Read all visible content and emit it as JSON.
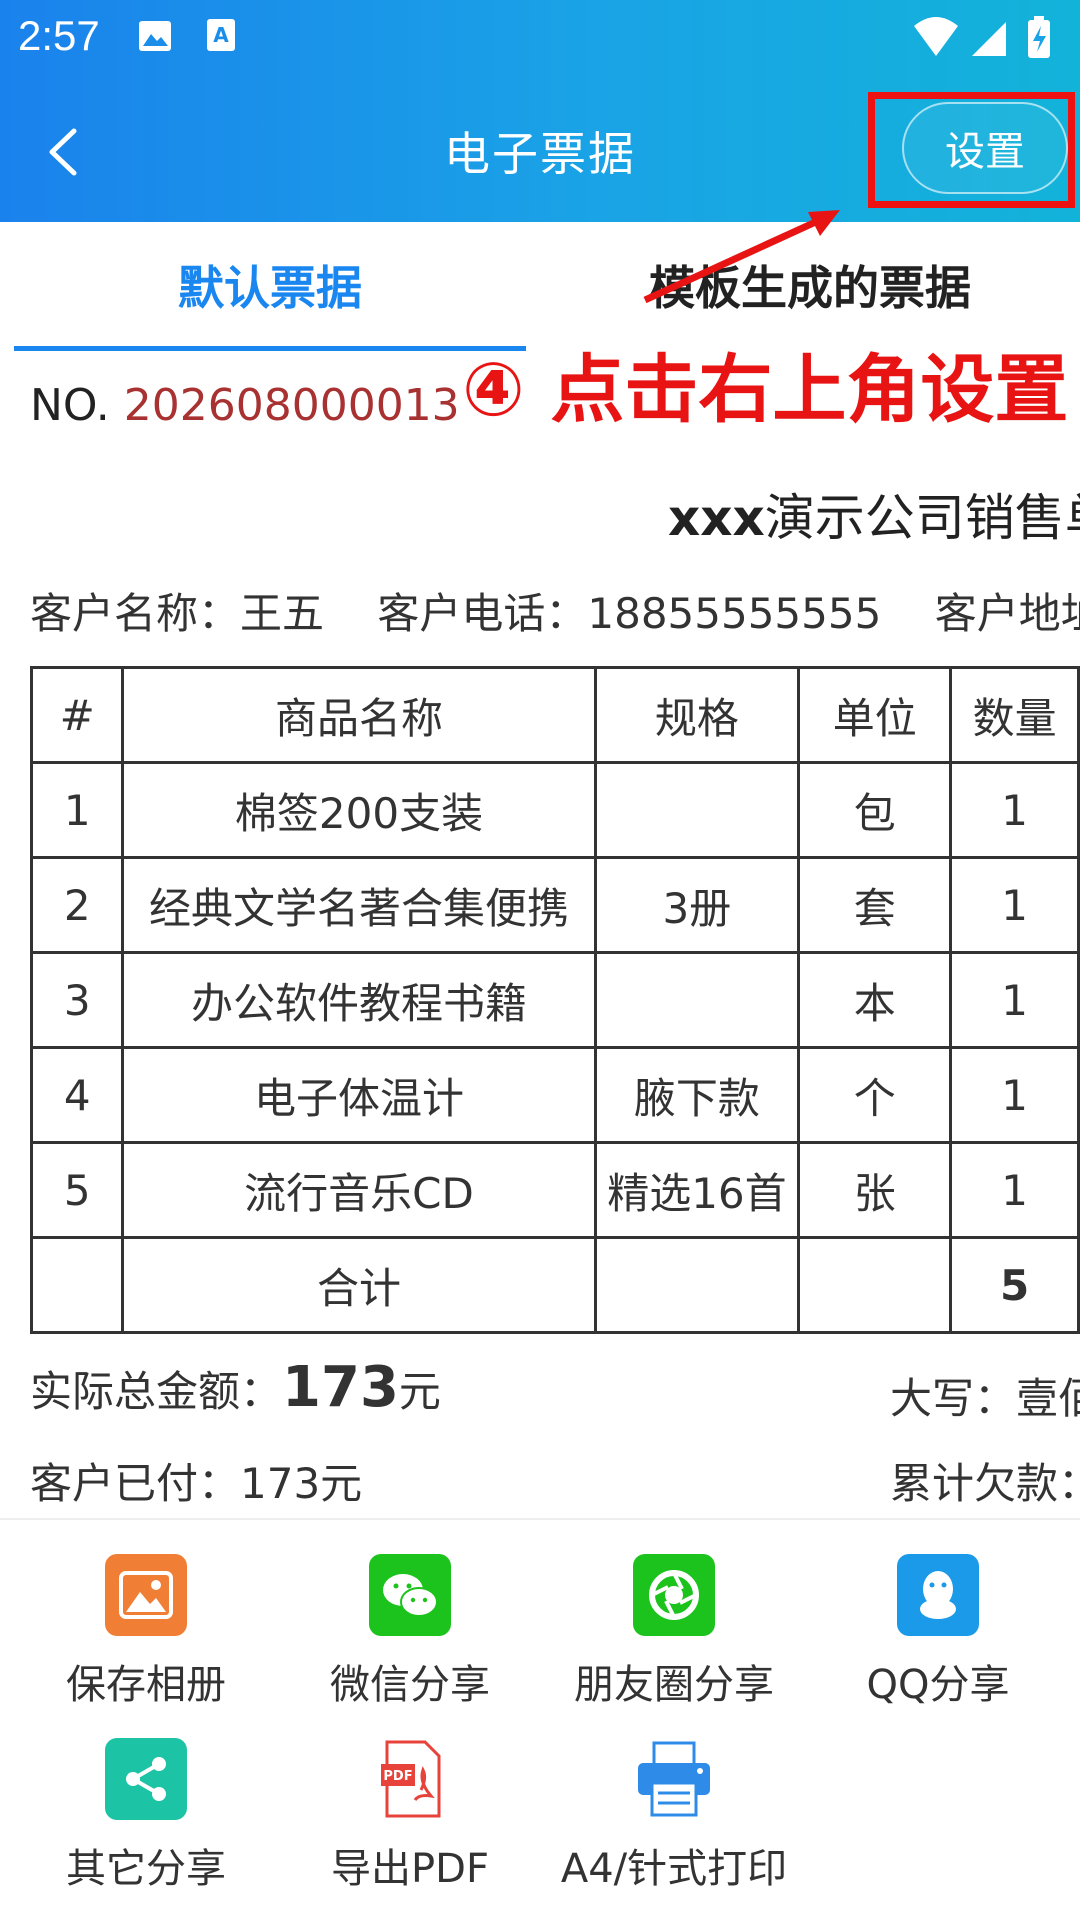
{
  "status_bar": {
    "time": "2:57"
  },
  "app_bar": {
    "title": "电子票据",
    "settings_label": "设置"
  },
  "tabs": [
    {
      "label": "默认票据",
      "active": true
    },
    {
      "label": "模板生成的票据",
      "active": false
    }
  ],
  "annotation": {
    "text": "④ 点击右上角设置",
    "color": "#e81414"
  },
  "receipt": {
    "no_label": "NO.",
    "no_value": "202608000013",
    "title_bold": "xxx",
    "title_rest": "演示公司销售单",
    "customer_name": "客户名称：王五",
    "customer_phone": "客户电话：18855555555",
    "customer_address": "客户地址",
    "table": {
      "headers": [
        "#",
        "商品名称",
        "规格",
        "单位",
        "数量"
      ],
      "rows": [
        [
          "1",
          "棉签200支装",
          "",
          "包",
          "1"
        ],
        [
          "2",
          "经典文学名著合集便携",
          "3册",
          "套",
          "1"
        ],
        [
          "3",
          "办公软件教程书籍",
          "",
          "本",
          "1"
        ],
        [
          "4",
          "电子体温计",
          "腋下款",
          "个",
          "1"
        ],
        [
          "5",
          "流行音乐CD",
          "精选16首",
          "张",
          "1"
        ]
      ],
      "total_label": "合计",
      "total_qty": "5"
    },
    "actual_total_label": "实际总金额：",
    "actual_total_value": "173",
    "actual_total_unit": "元",
    "uppercase_label": "大写：壹佰",
    "paid_label": "客户已付：173元",
    "owed_label": "累计欠款："
  },
  "actions": [
    {
      "label": "保存相册",
      "icon": "gallery-icon",
      "color": "#f07f35"
    },
    {
      "label": "微信分享",
      "icon": "wechat-icon",
      "color": "#1dc31d"
    },
    {
      "label": "朋友圈分享",
      "icon": "moments-icon",
      "color": "#1dc31d"
    },
    {
      "label": "QQ分享",
      "icon": "qq-icon",
      "color": "#1a9ae8"
    },
    {
      "label": "其它分享",
      "icon": "share-icon",
      "color": "#1cc3a4"
    },
    {
      "label": "导出PDF",
      "icon": "pdf-icon",
      "color": "#e8433b"
    },
    {
      "label": "A4/针式打印",
      "icon": "printer-icon",
      "color": "#2e8ce8"
    }
  ]
}
